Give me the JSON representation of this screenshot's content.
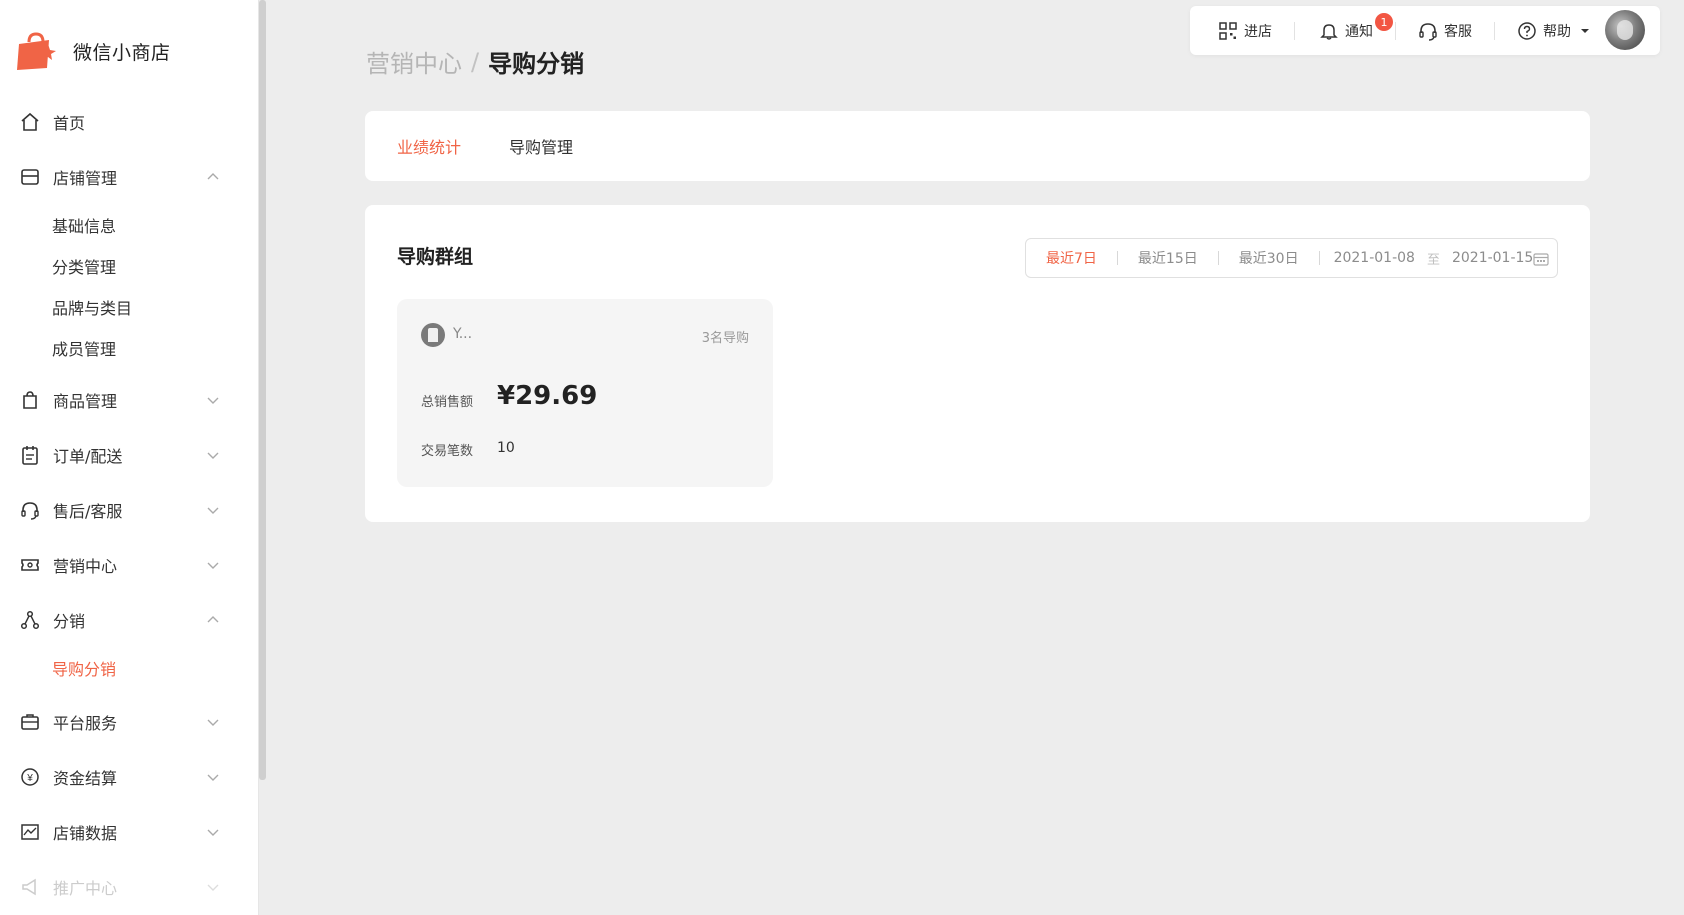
{
  "app": {
    "name": "微信小商店",
    "brand_color": "#f06446"
  },
  "sidebar": {
    "items": [
      {
        "label": "首页",
        "icon": "home-icon",
        "expanded": null
      },
      {
        "label": "店铺管理",
        "icon": "store-icon",
        "expanded": true,
        "children": [
          "基础信息",
          "分类管理",
          "品牌与类目",
          "成员管理"
        ]
      },
      {
        "label": "商品管理",
        "icon": "bag-icon",
        "expanded": false
      },
      {
        "label": "订单/配送",
        "icon": "clipboard-icon",
        "expanded": false
      },
      {
        "label": "售后/客服",
        "icon": "headset-icon",
        "expanded": false
      },
      {
        "label": "营销中心",
        "icon": "ticket-icon",
        "expanded": false
      },
      {
        "label": "分销",
        "icon": "share-nodes-icon",
        "expanded": true,
        "children": [
          "导购分销"
        ],
        "active_child": "导购分销"
      },
      {
        "label": "平台服务",
        "icon": "briefcase-icon",
        "expanded": false
      },
      {
        "label": "资金结算",
        "icon": "yen-coin-icon",
        "expanded": false
      },
      {
        "label": "店铺数据",
        "icon": "chart-icon",
        "expanded": false
      },
      {
        "label": "推广中心",
        "icon": "megaphone-icon",
        "expanded": false
      }
    ]
  },
  "toolbar": {
    "enter_store": "进店",
    "notify": "通知",
    "notify_badge": "1",
    "service": "客服",
    "help": "帮助"
  },
  "breadcrumb": {
    "parent": "营销中心",
    "separator": "/",
    "current": "导购分销"
  },
  "tabs": [
    {
      "label": "业绩统计",
      "active": true
    },
    {
      "label": "导购管理",
      "active": false
    }
  ],
  "section": {
    "title": "导购群组",
    "range_options": [
      {
        "label": "最近7日",
        "active": true
      },
      {
        "label": "最近15日",
        "active": false
      },
      {
        "label": "最近30日",
        "active": false
      }
    ],
    "date_start": "2021-01-08",
    "date_to": "至",
    "date_end": "2021-01-15"
  },
  "group_card": {
    "name": "Y...",
    "guide_count": "3名导购",
    "sales_label": "总销售额",
    "sales_value": "¥29.69",
    "txn_label": "交易笔数",
    "txn_value": "10"
  }
}
